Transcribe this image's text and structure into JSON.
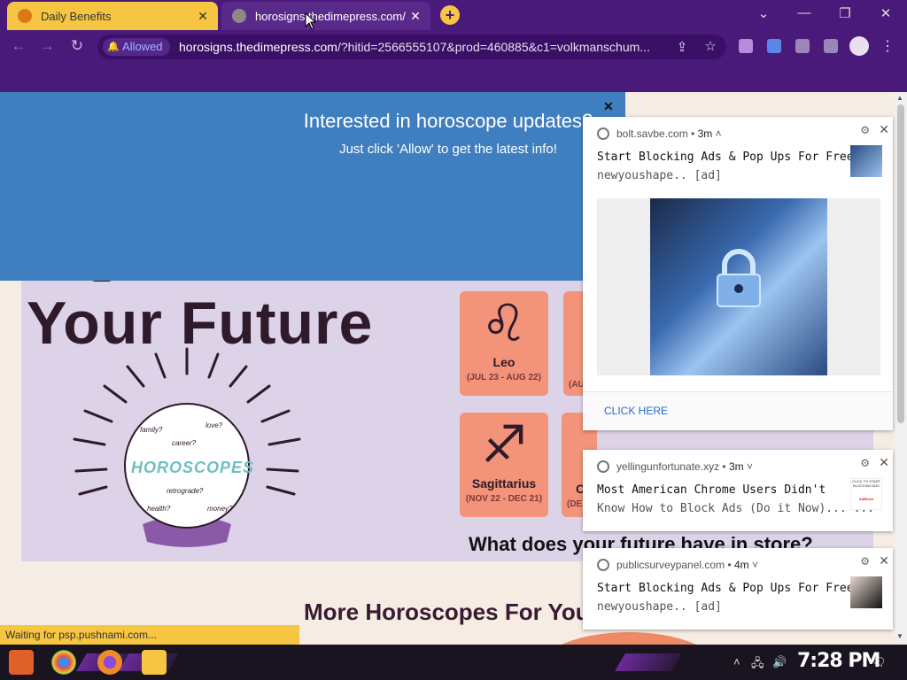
{
  "tabs": [
    {
      "title": "Daily Benefits"
    },
    {
      "title": "horosigns.thedimepress.com/?l"
    }
  ],
  "toolbar": {
    "allowed_label": "Allowed",
    "url_host": "horosigns.thedimepress.com",
    "url_rest": "/?hitid=2566555107&prod=460885&c1=volkmanschum..."
  },
  "optin": {
    "heading": "Interested in horoscope updates?",
    "sub": "Just click 'Allow' to get the latest info!"
  },
  "hero": {
    "title": "Your Future",
    "crystal_label": "HOROSCOPES",
    "crystal_words": [
      "family?",
      "love?",
      "career?",
      "retrograde?",
      "health?",
      "money?"
    ]
  },
  "zodiac": [
    {
      "glyph": "♌",
      "name": "Leo",
      "dates": "(JUL 23 - AUG 22)"
    },
    {
      "glyph": "♐",
      "name": "Sagittarius",
      "dates": "(NOV 22 - DEC 21)"
    },
    {
      "dates_partial": "(AU",
      "partial_name": "C",
      "dates_partial_2": "(DE"
    }
  ],
  "question": "What does your future have in store?",
  "more_title": "More Horoscopes For You",
  "notifications": [
    {
      "source": "bolt.savbe.com",
      "time": "3m",
      "title": "Start Blocking Ads & Pop Ups For Free",
      "body": "newyoushape.. [ad]",
      "cta": "CLICK HERE"
    },
    {
      "source": "yellingunfortunate.xyz",
      "time": "3m",
      "title": "Most American Chrome Users Didn't",
      "body": "Know How to Block Ads (Do it Now)... ...",
      "thumb_caption": "CLICK TO START BLOCKING ADS",
      "thumb_brand": "AdBlock"
    },
    {
      "source": "publicsurveypanel.com",
      "time": "4m",
      "title": "Start Blocking Ads & Pop Ups For Free",
      "body": "newyoushape.. [ad]"
    }
  ],
  "status": "Waiting for psp.pushnami.com...",
  "clock": "7:28 PM",
  "colors": {
    "chrome_purple": "#4a1a7a",
    "tab_yellow": "#f6c542",
    "optin_blue": "#3f7fbf",
    "zodiac_coral": "#f2937a",
    "panel_lilac": "#ddd3e8",
    "link_blue": "#2a6acb"
  }
}
